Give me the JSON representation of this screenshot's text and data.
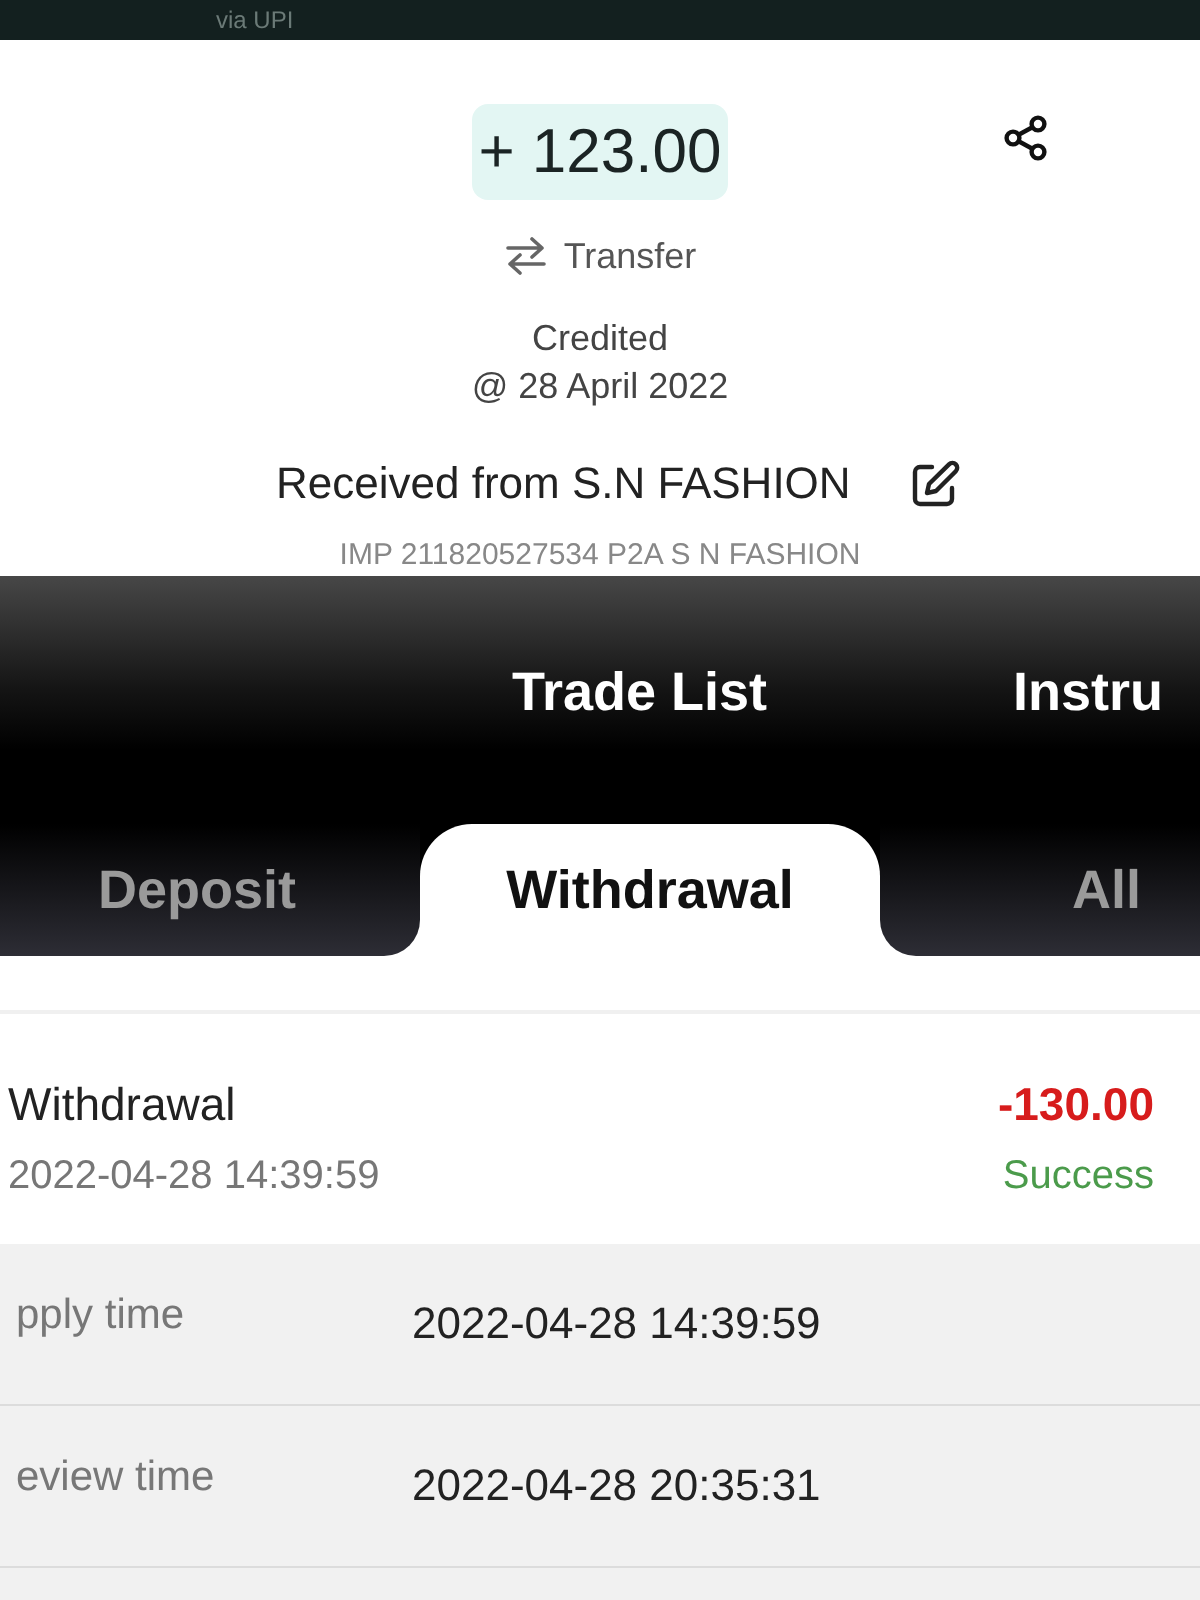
{
  "bank_detail": {
    "header_text": "via UPI",
    "amount": "+ 123.00",
    "type": "Transfer",
    "status": "Credited",
    "date": "@ 28 April 2022",
    "counterparty": "Received from S.N FASHION",
    "reference": "IMP 211820527534 P2A S N FASHION"
  },
  "trade_app": {
    "header_tabs": [
      {
        "label": "Trade List"
      },
      {
        "label": "Instru"
      }
    ],
    "filter_tabs": [
      {
        "label": "Deposit",
        "selected": false
      },
      {
        "label": "Withdrawal",
        "selected": true
      },
      {
        "label": "All",
        "selected": false
      }
    ],
    "record": {
      "title": "Withdrawal",
      "time": "2022-04-28 14:39:59",
      "amount": "-130.00",
      "status": "Success"
    },
    "details": [
      {
        "label": "pply time",
        "value": "2022-04-28 14:39:59"
      },
      {
        "label": "eview time",
        "value": "2022-04-28 20:35:31"
      }
    ]
  }
}
